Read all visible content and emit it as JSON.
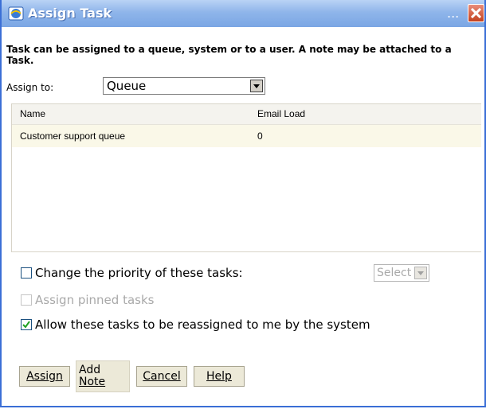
{
  "window": {
    "title": "Assign Task",
    "title_dots": "..."
  },
  "intro": "Task can be assigned to a queue, system or to a user. A note may be attached to a Task.",
  "assign": {
    "label": "Assign to:",
    "selected": "Queue"
  },
  "table": {
    "columns": [
      "Name",
      "Email Load"
    ],
    "rows": [
      {
        "name": "Customer support queue",
        "load": "0"
      }
    ]
  },
  "options": {
    "priority": {
      "label": "Change the priority of these tasks:",
      "checked": false,
      "select_value": "Select"
    },
    "pinned": {
      "label": "Assign pinned tasks",
      "checked": false,
      "disabled": true
    },
    "reassign": {
      "label": "Allow these tasks to be reassigned to me by the system",
      "checked": true
    }
  },
  "buttons": {
    "assign": "Assign",
    "add_note_line1": "Add",
    "add_note_line2": "Note",
    "cancel": "Cancel",
    "help": "Help"
  }
}
